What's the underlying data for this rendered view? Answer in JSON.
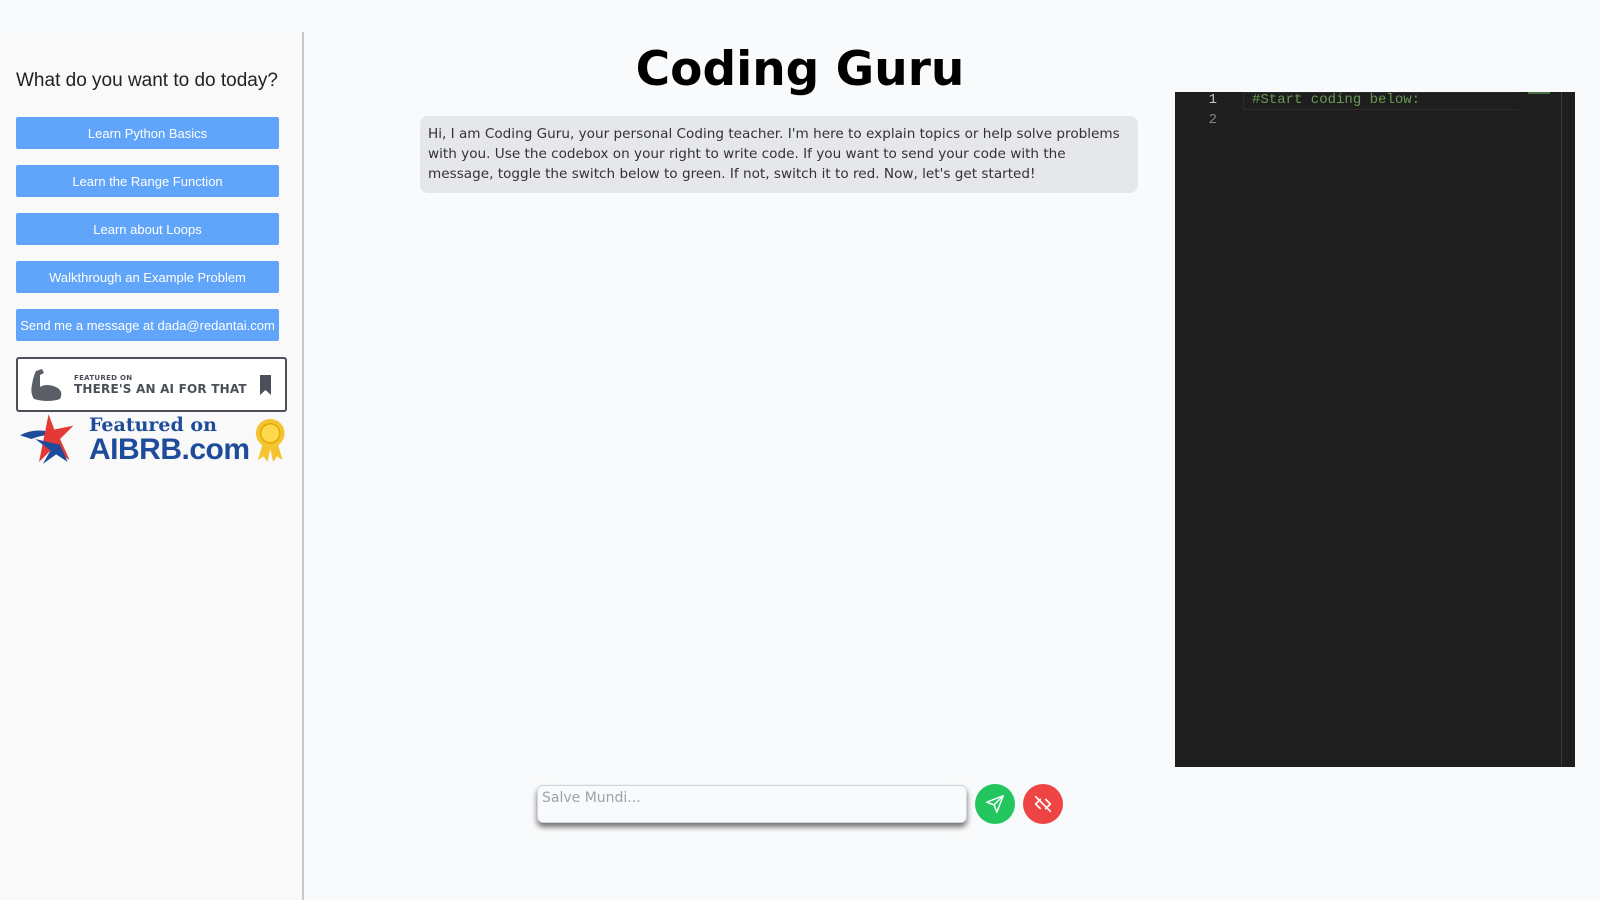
{
  "sidebar": {
    "heading": "What do you want to do today?",
    "buttons": [
      {
        "label": "Learn Python Basics"
      },
      {
        "label": "Learn the Range Function"
      },
      {
        "label": "Learn about Loops"
      },
      {
        "label": "Walkthrough an Example Problem"
      },
      {
        "label": "Send me a message at dada@redantai.com"
      }
    ],
    "badges": {
      "taaft": {
        "small": "FEATURED ON",
        "big": "THERE'S AN AI FOR THAT"
      },
      "aibrb": {
        "featured": "Featured on",
        "domain": "AIBRB.com"
      }
    }
  },
  "main": {
    "title": "Coding Guru",
    "messages": [
      {
        "role": "assistant",
        "text": "Hi, I am Coding Guru, your personal Coding teacher. I'm here to explain topics or help solve problems with you. Use the codebox on your right to write code. If you want to send your code with the message, toggle the switch below to green. If not, switch it to red. Now, let's get started!"
      }
    ],
    "input": {
      "value": "",
      "placeholder": "Salve Mundi..."
    },
    "send_button": {
      "icon": "send-icon",
      "color": "#22c55e"
    },
    "code_toggle": {
      "icon": "code-off-icon",
      "color": "#ef4444",
      "state": "off"
    }
  },
  "editor": {
    "lines": [
      {
        "number": "1",
        "code": "#Start coding below:"
      },
      {
        "number": "2",
        "code": ""
      }
    ]
  },
  "colors": {
    "button": "#60a5fa",
    "bubble": "#e5e7eb",
    "editor_bg": "#1e1e1e",
    "comment": "#6a9955"
  }
}
